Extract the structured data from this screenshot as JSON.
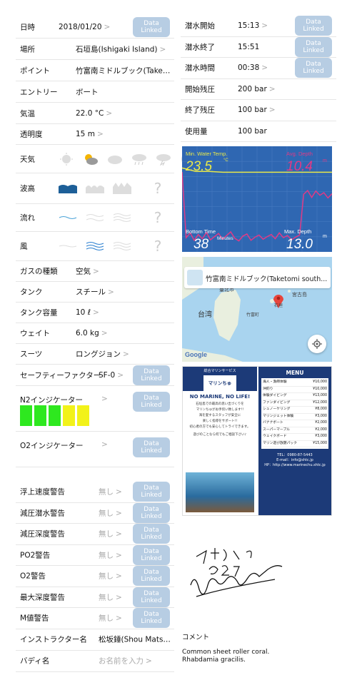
{
  "badge": "Data Linked",
  "left_rows": [
    {
      "label": "日時",
      "value": "2018/01/20",
      "chev": true,
      "badge": true
    },
    {
      "label": "場所",
      "value": "石垣島(Ishigaki Island)",
      "chev": true
    },
    {
      "label": "ポイント",
      "value": "竹富南ミドルブック(Taketo...",
      "chev": false
    },
    {
      "label": "エントリー",
      "value": "ボート",
      "chev": false
    },
    {
      "label": "気温",
      "value": "22.0 °C",
      "chev": true
    },
    {
      "label": "透明度",
      "value": "15 m",
      "chev": true
    }
  ],
  "conditions": {
    "weather_label": "天気",
    "wave_label": "波高",
    "current_label": "流れ",
    "wind_label": "風",
    "unknown_mark": "?"
  },
  "left_rows2": [
    {
      "label": "ガスの種類",
      "value": "空気"
    },
    {
      "label": "タンク",
      "value": "スチール"
    },
    {
      "label": "タンク容量",
      "value": "10 ℓ"
    },
    {
      "label": "ウェイト",
      "value": "6.0 kg"
    },
    {
      "label": "スーツ",
      "value": "ロングジョン"
    }
  ],
  "safety": {
    "label": "セーフティーファクター",
    "value": "SF-0"
  },
  "n2": {
    "label": "N2インジケーター",
    "colors": [
      "#2ee81f",
      "#2ee81f",
      "#2ee81f",
      "#f2f21a",
      "#f2f21a"
    ]
  },
  "o2": {
    "label": "O2インジケーター"
  },
  "alarms": [
    {
      "label": "浮上速度警告",
      "value": "無し"
    },
    {
      "label": "減圧潜水警告",
      "value": "無し"
    },
    {
      "label": "減圧深度警告",
      "value": "無し"
    },
    {
      "label": "PO2警告",
      "value": "無し"
    },
    {
      "label": "O2警告",
      "value": "無し"
    },
    {
      "label": "最大深度警告",
      "value": "無し"
    },
    {
      "label": "M値警告",
      "value": "無し"
    }
  ],
  "instructor": {
    "label": "インストラクター名",
    "value": "松坂錘(Shou Matsu..."
  },
  "buddy": {
    "label": "バディ名",
    "placeholder": "お名前を入力"
  },
  "right_rows": [
    {
      "label": "潜水開始",
      "value": "15:13",
      "chev": true,
      "badge": true
    },
    {
      "label": "潜水終了",
      "value": "15:51",
      "chev": false,
      "badge": true
    },
    {
      "label": "潜水時間",
      "value": "00:38",
      "chev": true,
      "badge": true
    },
    {
      "label": "開始残圧",
      "value": "200 bar",
      "chev": true,
      "badge": false
    },
    {
      "label": "終了残圧",
      "value": "100 bar",
      "chev": true,
      "badge": false
    },
    {
      "label": "使用量",
      "value": "100 bar",
      "chev": false,
      "badge": false
    }
  ],
  "chart_data": {
    "type": "line",
    "min_water_temp_label": "Min. Water Temp.",
    "min_water_temp": "23.5",
    "temp_unit": "°C",
    "avg_depth_label": "Avg. Depth",
    "avg_depth": "10.4",
    "depth_unit": "m",
    "bottom_time_label": "Bottom Time",
    "bottom_time": "38",
    "bottom_time_unit": "Minutes",
    "max_depth_label": "Max. Depth",
    "max_depth": "13.0",
    "max_depth_unit": "m",
    "depth_profile": [
      0,
      12.4,
      11.5,
      12.9,
      11.8,
      12.6,
      11.4,
      12.8,
      12.2,
      11.6,
      12.7,
      12.0,
      11.3,
      12.5,
      13.0,
      12.1,
      11.7,
      12.9,
      12.3,
      11.9,
      12.7,
      12.2,
      11.8,
      12.6,
      11.5,
      12.4,
      12.0,
      12.8,
      12.3,
      11.9,
      4.2,
      3.5,
      4.8,
      3.6,
      4.4,
      3.9,
      4.9,
      4.1
    ],
    "temp_profile": [
      24.0,
      23.6,
      23.6,
      23.5,
      23.5,
      23.5,
      23.5,
      23.5,
      23.5,
      23.5,
      23.5,
      23.5
    ]
  },
  "map": {
    "title": "竹富南ミドルブック(Taketomi south...",
    "labels": {
      "taipei": "臺北市",
      "taiwan": "台湾",
      "miyako": "宮古島",
      "ishigaki": "石垣",
      "taketomi": "竹富町"
    },
    "google": "Google"
  },
  "flyer": {
    "company": "総合マリンサービス",
    "brand": "マリンちゅ",
    "headline": "NO MARINE, NO LIFE!",
    "body": [
      "石垣島での最高の思い出づくりを",
      "マリンちゅがお手伝い致します!!",
      "海を愛するスタッフが安全に",
      "楽しく指導をサポート!!",
      "初心者の方でも安心してトライできます。"
    ],
    "tagline": "遊びのことなら何でもご相談下さい♪",
    "menu_title": "MENU",
    "menu": [
      {
        "name": "海人・漁師体験",
        "price": "¥10,000"
      },
      {
        "name": "沖釣り",
        "price": "¥10,000"
      },
      {
        "name": "体験ダイビング",
        "price": "¥13,000"
      },
      {
        "name": "ファンダイビング",
        "price": "¥12,000"
      },
      {
        "name": "シュノーケリング",
        "price": "¥8,000"
      },
      {
        "name": "マリンジェット体験",
        "price": "¥3,000"
      },
      {
        "name": "バナナボート",
        "price": "¥2,000"
      },
      {
        "name": "スーパーマーブル",
        "price": "¥2,000"
      },
      {
        "name": "ウェイクボード",
        "price": "¥3,000"
      },
      {
        "name": "マリン遊び放題パック",
        "price": "¥15,000"
      }
    ],
    "tel": "TEL：0980-87-5443",
    "email": "E-mail：info@shtc.jp",
    "hp": "HP：http://www.marinechu.shtc.jp"
  },
  "signature_text": "マリーちゅ 22.72",
  "comment": {
    "label": "コメント",
    "text1": "Common sheet roller coral.",
    "text2": "Rhabdamia gracilis."
  }
}
